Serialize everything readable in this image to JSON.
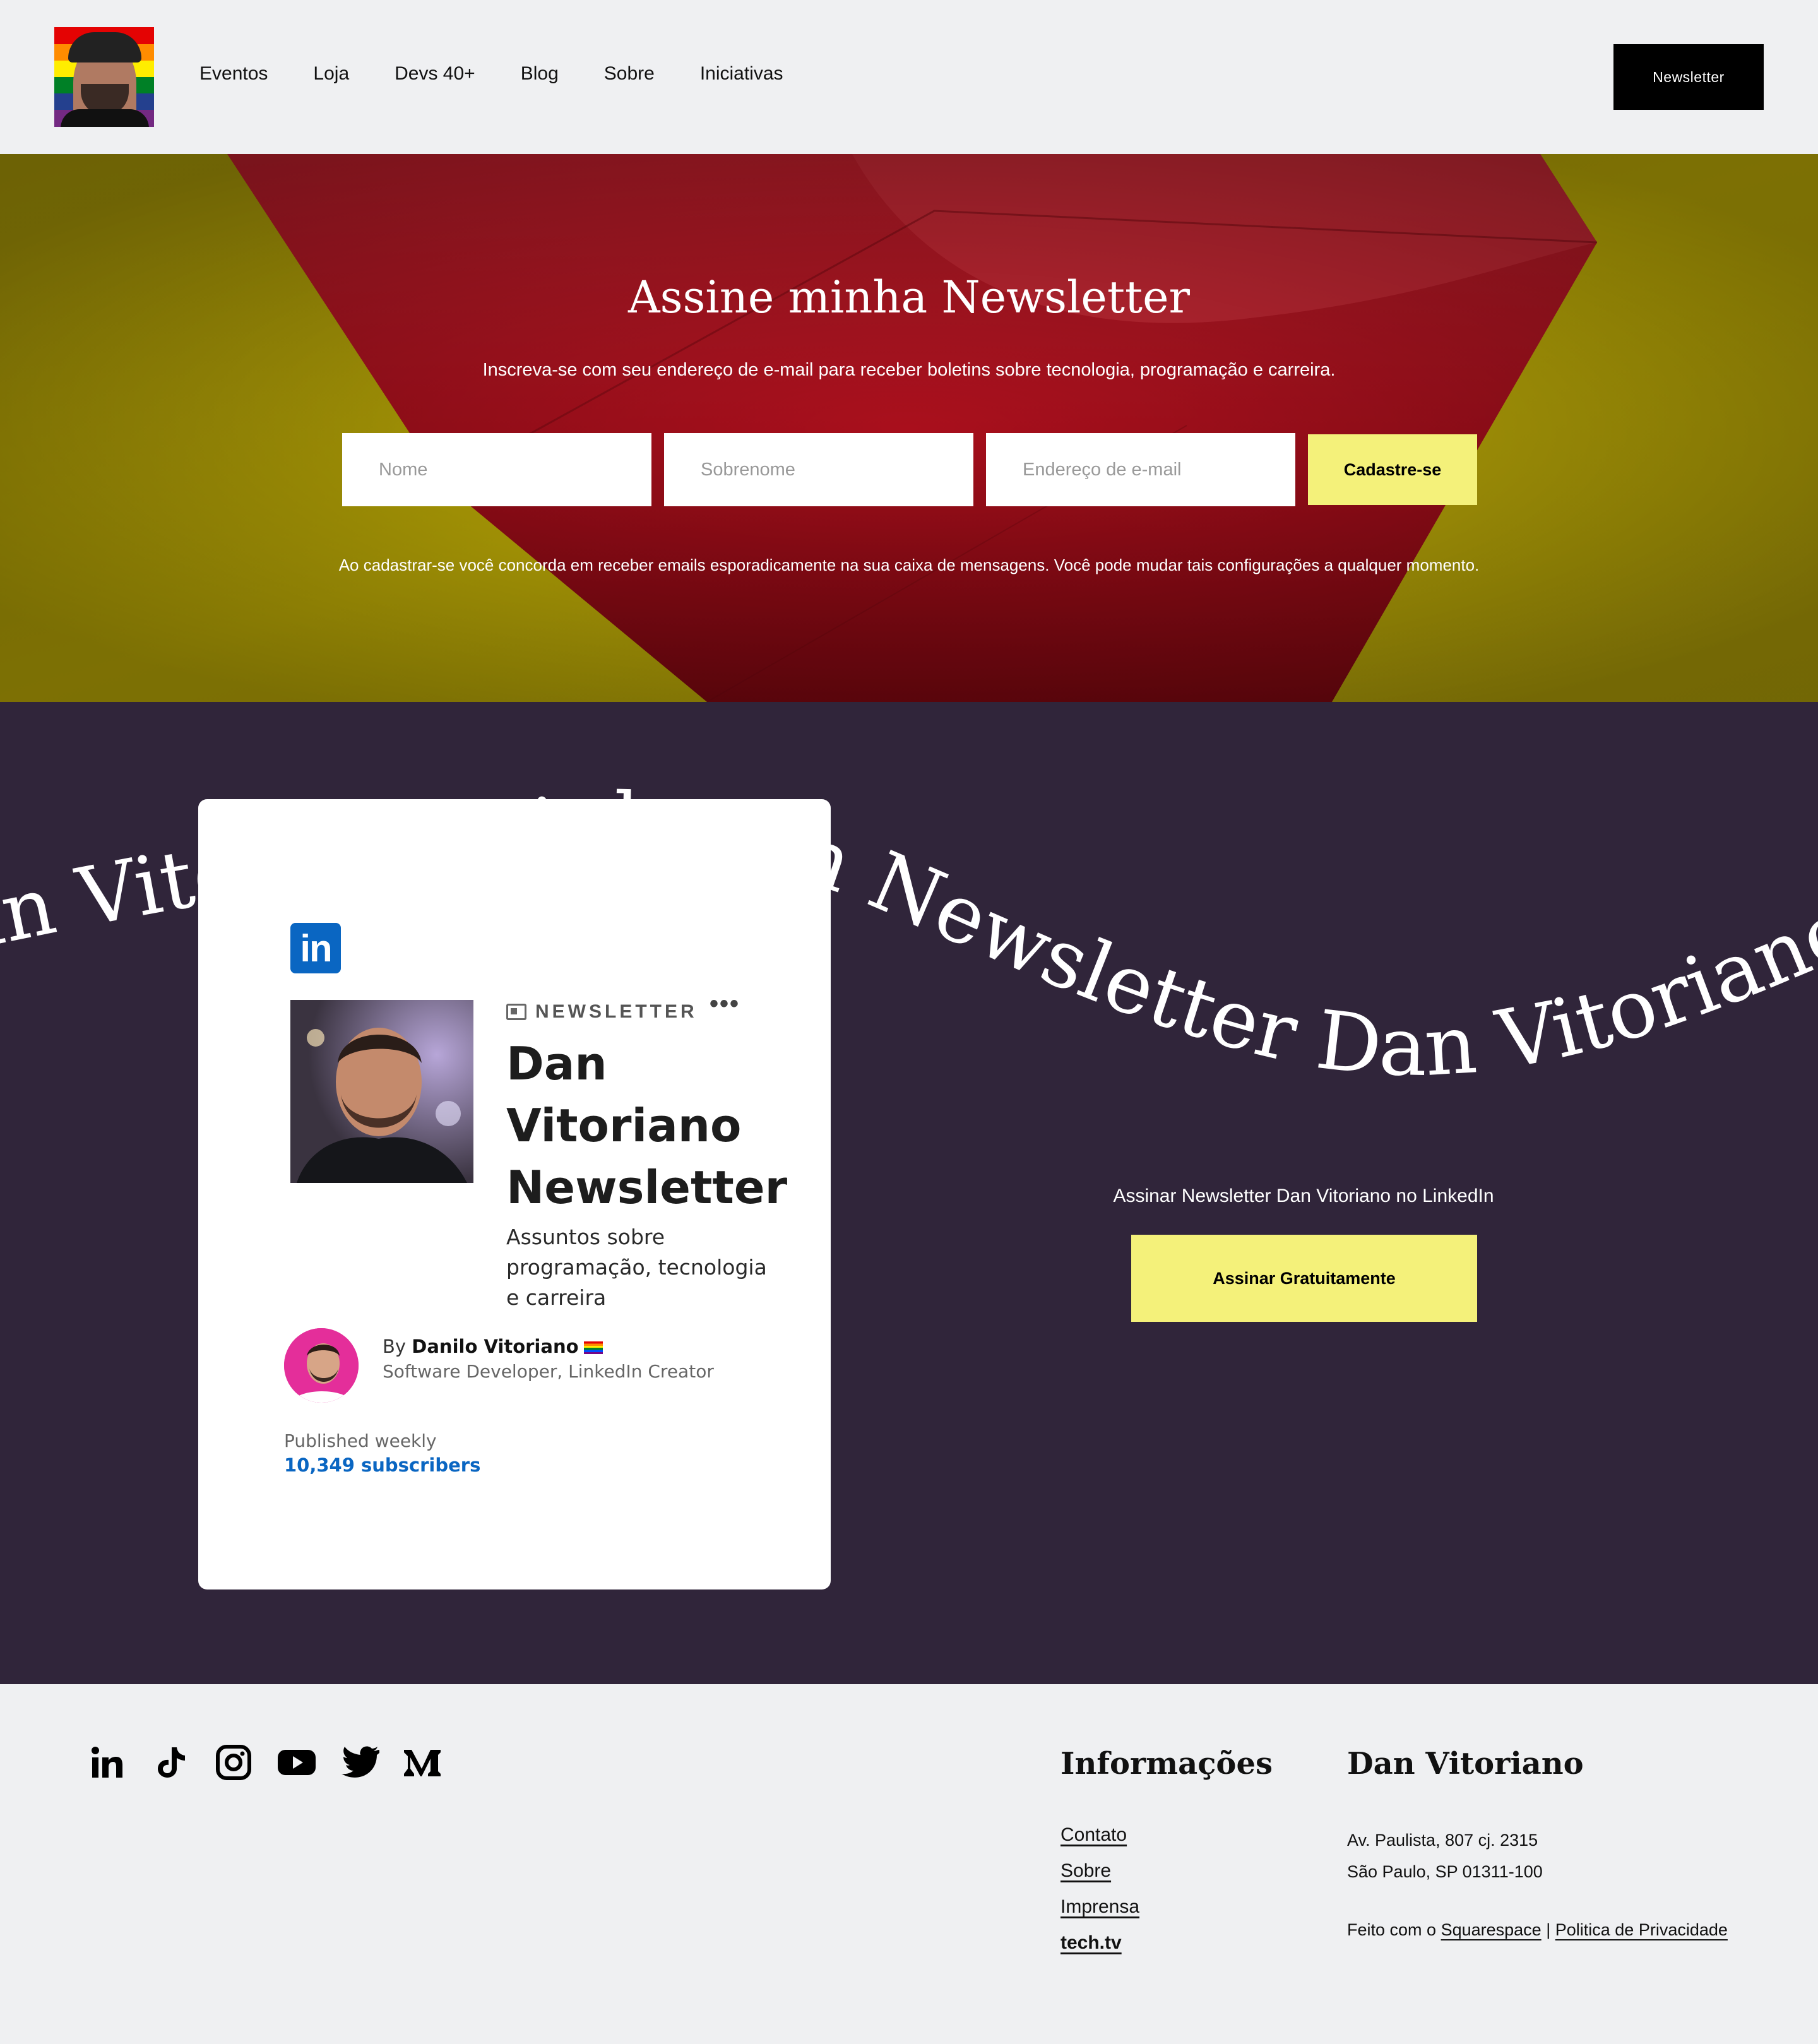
{
  "header": {
    "nav": [
      "Eventos",
      "Loja",
      "Devs 40+",
      "Blog",
      "Sobre",
      "Iniciativas"
    ],
    "cta_label": "Newsletter"
  },
  "hero": {
    "title": "Assine minha Newsletter",
    "subtitle": "Inscreva-se com seu endereço de e-mail para receber boletins sobre tecnologia, programação e carreira.",
    "fields": {
      "first_name_placeholder": "Nome",
      "last_name_placeholder": "Sobrenome",
      "email_placeholder": "Endereço de e-mail"
    },
    "submit_label": "Cadastre-se",
    "note": "Ao cadastrar-se você concorda em receber emails esporadicamente na sua caixa de mensagens. Você pode mudar tais configurações a qualquer momento.",
    "colors": {
      "background": "#b8a807",
      "envelope": "#a50f1c"
    }
  },
  "promo": {
    "ribbon_text": "Newsletter Dan Vitoriano  LinkedIn Newsletter Dan Vitoriano  LinkedIn Newsletter Dan Vitoriano  LinkedIn",
    "card": {
      "logo": "in",
      "newsletter_label": "NEWSLETTER",
      "more": "•••",
      "title": "Dan Vitoriano Newsletter",
      "description": "Assuntos sobre programação, tecnologia e carreira",
      "by_prefix": "By",
      "author": "Danilo Vitoriano",
      "role": "Software Developer, LinkedIn Creator",
      "frequency": "Published weekly",
      "subscribers": "10,349 subscribers"
    },
    "text": "Assinar Newsletter Dan Vitoriano no LinkedIn",
    "button_label": "Assinar Gratuitamente",
    "colors": {
      "background": "#30253a",
      "accent": "#f4f17a",
      "linkedin": "#0a66c2"
    }
  },
  "footer": {
    "socials": [
      "linkedin-icon",
      "tiktok-icon",
      "instagram-icon",
      "youtube-icon",
      "twitter-icon",
      "medium-icon"
    ],
    "info_heading": "Informações",
    "links": [
      "Contato",
      "Sobre",
      "Imprensa",
      "tech.tv"
    ],
    "brand_heading": "Dan Vitoriano",
    "address_line1": "Av. Paulista, 807 cj. 2315",
    "address_line2": "São Paulo, SP 01311-100",
    "credit_prefix": "Feito com o",
    "credit_link": "Squarespace",
    "separator": "|",
    "privacy_link": "Politica de Privacidade"
  }
}
